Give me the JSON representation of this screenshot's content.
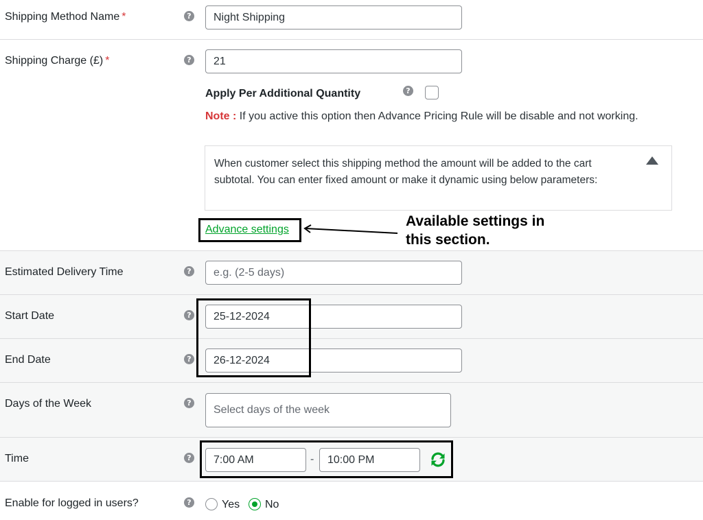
{
  "fields": {
    "method_name": {
      "label": "Shipping Method Name",
      "required_mark": "*",
      "value": "Night Shipping"
    },
    "charge": {
      "label": "Shipping Charge (£)",
      "required_mark": "*",
      "value": "21"
    },
    "per_quantity": {
      "label": "Apply Per Additional Quantity",
      "checked": false
    },
    "note": {
      "label": "Note :",
      "text": " If you active this option then Advance Pricing Rule will be disable and not working."
    },
    "description": "When customer select this shipping method the amount will be added to the cart subtotal. You can enter fixed amount or make it dynamic using below parameters:",
    "advance_link": "Advance settings",
    "delivery_time": {
      "label": "Estimated Delivery Time",
      "placeholder": "e.g. (2-5 days)"
    },
    "start_date": {
      "label": "Start Date",
      "value": "25-12-2024"
    },
    "end_date": {
      "label": "End Date",
      "value": "26-12-2024"
    },
    "days_of_week": {
      "label": "Days of the Week",
      "placeholder": "Select days of the week"
    },
    "time": {
      "label": "Time",
      "from": "7:00 AM",
      "separator": "-",
      "to": "10:00 PM"
    },
    "logged_in": {
      "label": "Enable for logged in users?",
      "options": [
        "Yes",
        "No"
      ],
      "selected": "No"
    }
  },
  "help_icon_glyph": "?",
  "annotation": "Available settings in\nthis section.",
  "colors": {
    "accent_green": "#00a32a",
    "required_red": "#d63638",
    "highlight_frame": "#000000"
  }
}
